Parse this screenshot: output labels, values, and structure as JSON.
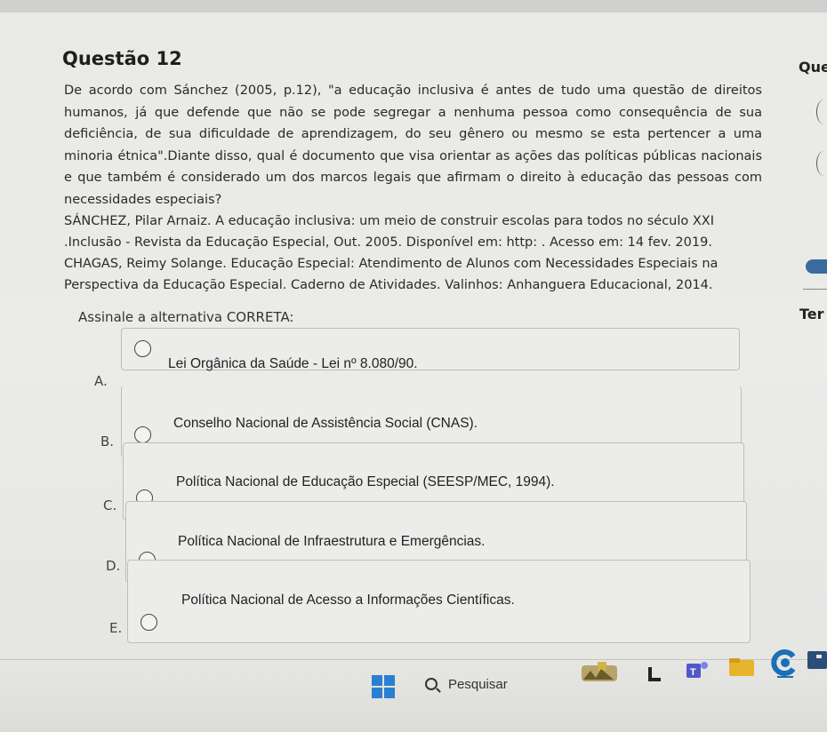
{
  "question": {
    "title": "Questão 12",
    "text": "De acordo com Sánchez (2005, p.12), \"a educação inclusiva é antes de tudo uma questão de direitos humanos, já que defende que não se pode segregar a nenhuma pessoa como consequência de sua deficiência, de sua dificuldade de aprendizagem, do seu gênero ou mesmo se esta pertencer a uma minoria étnica\".Diante disso, qual é documento que visa orientar as ações das políticas públicas nacionais e que também é considerado um dos marcos legais que afirmam o direito à educação das pessoas com necessidades especiais?",
    "ref1_line1": "SÁNCHEZ, Pilar Arnaiz. A educação inclusiva: um meio de construir escolas para todos no século XXI",
    "ref1_line2": ".Inclusão - Revista da Educação Especial, Out. 2005. Disponível em: http: . Acesso em: 14 fev. 2019.",
    "ref2_line1": "CHAGAS, Reimy Solange. Educação Especial: Atendimento de Alunos com Necessidades Especiais na",
    "ref2_line2": "Perspectiva da Educação Especial. Caderno de Atividades. Valinhos: Anhanguera Educacional, 2014.",
    "prompt": "Assinale a alternativa CORRETA:"
  },
  "options": [
    {
      "letter": "A.",
      "label": "Lei Orgânica da Saúde - Lei nº 8.080/90."
    },
    {
      "letter": "B.",
      "label": "Conselho Nacional de Assistência Social (CNAS)."
    },
    {
      "letter": "C.",
      "label": "Política Nacional de Educação Especial (SEESP/MEC, 1994)."
    },
    {
      "letter": "D.",
      "label": "Política Nacional de Infraestrutura e Emergências."
    },
    {
      "letter": "E.",
      "label": "Política Nacional de Acesso a Informações Científicas."
    }
  ],
  "side_panel": {
    "title_fragment": "Ques",
    "ter_fragment": "Ter"
  },
  "taskbar": {
    "search_label": "Pesquisar",
    "icons": [
      "windows-start-icon",
      "search-icon",
      "widgets-icon",
      "task-view-icon",
      "teams-icon",
      "file-explorer-icon",
      "chrome-icon",
      "store-icon"
    ]
  },
  "colors": {
    "windows_blue": "#2a7fd4",
    "text_dark": "#222222",
    "option_border": "#bdbdbb"
  }
}
